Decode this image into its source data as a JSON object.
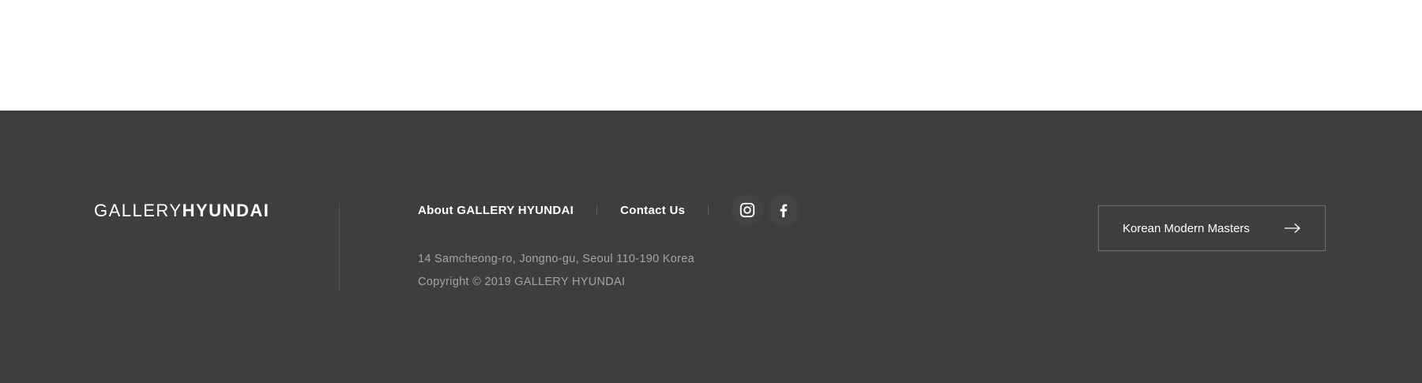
{
  "footer": {
    "logo": {
      "light": "GALLERY",
      "bold": "HYUNDAI"
    },
    "nav": [
      {
        "label": "About GALLERY HYUNDAI"
      },
      {
        "label": "Contact Us"
      }
    ],
    "social": [
      {
        "icon": "instagram-icon"
      },
      {
        "icon": "facebook-icon"
      }
    ],
    "address": "14 Samcheong-ro, Jongno-gu, Seoul 110-190 Korea",
    "copyright": "Copyright © 2019 GALLERY HYUNDAI",
    "cta": {
      "label": "Korean Modern Masters",
      "icon": "arrow-right-icon"
    },
    "colors": {
      "background": "#3e3e3e",
      "text": "#ffffff",
      "muted": "#a4a4a4"
    }
  }
}
